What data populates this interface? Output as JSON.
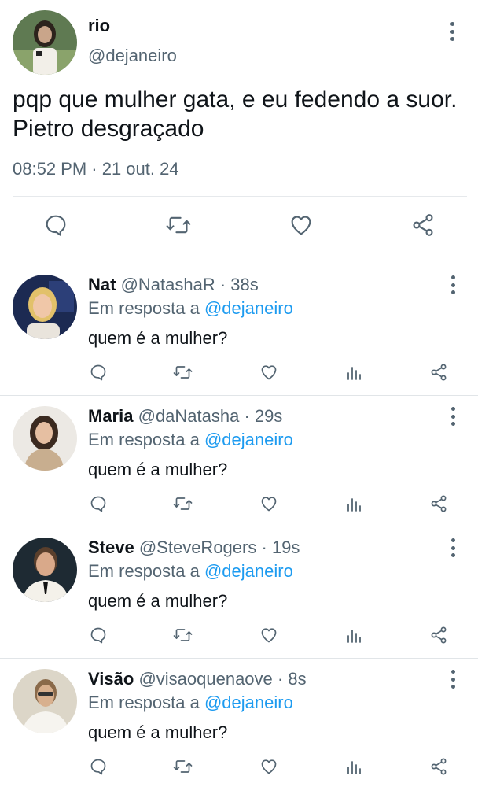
{
  "tweet": {
    "name": "rio",
    "handle": "@dejaneiro",
    "text": "pqp que mulher gata, e eu fedendo a suor.\nPietro desgraçado",
    "timestamp": "08:52 PM · 21 out. 24"
  },
  "reply_prefix": "Em resposta a",
  "replies": [
    {
      "name": "Nat",
      "handle": "@NatashaR · 38s",
      "mention": "@dejaneiro",
      "text": "quem é a mulher?"
    },
    {
      "name": "Maria",
      "handle": "@daNatasha · 29s",
      "mention": "@dejaneiro",
      "text": "quem é a mulher?"
    },
    {
      "name": "Steve",
      "handle": "@SteveRogers · 19s",
      "mention": "@dejaneiro",
      "text": "quem é a mulher?"
    },
    {
      "name": "Visão",
      "handle": "@visaoquenaove · 8s",
      "mention": "@dejaneiro",
      "text": "quem é a mulher?"
    }
  ],
  "colors": {
    "accent": "#1d9bf0",
    "secondary_text": "#536471",
    "icon": "#536471"
  }
}
